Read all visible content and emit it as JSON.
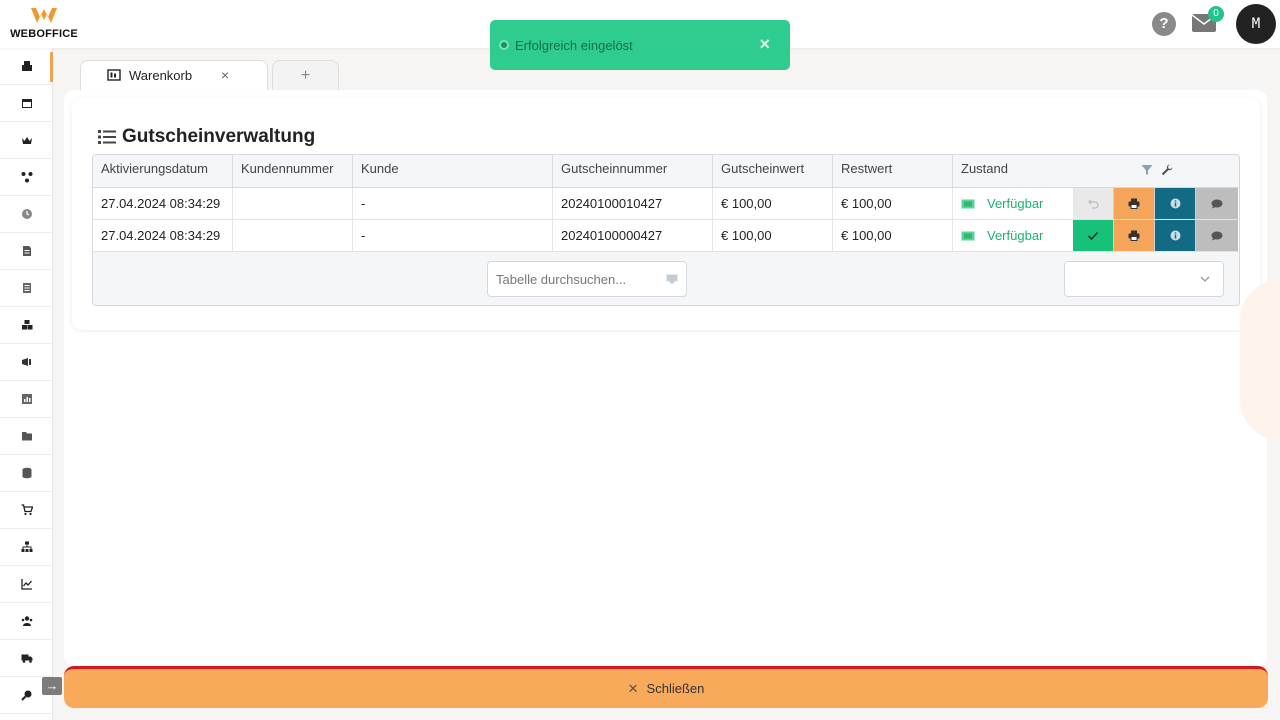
{
  "brand": {
    "logo_text": "WEBOFFICE"
  },
  "header": {
    "help_label": "?",
    "mail_count": "0",
    "avatar_initial": "M"
  },
  "toast": {
    "message": "Erfolgreich eingelöst",
    "close_label": "×"
  },
  "tabs": [
    {
      "label": "Warenkorb",
      "icon": "cart-list-icon",
      "close_label": "×"
    },
    {
      "label": "+"
    }
  ],
  "page": {
    "title": "Gutscheinverwaltung"
  },
  "table": {
    "columns": [
      "Aktivierungsdatum",
      "Kundennummer",
      "Kunde",
      "Gutscheinnummer",
      "Gutscheinwert",
      "Restwert",
      "Zustand"
    ],
    "rows": [
      {
        "aktivierungsdatum": "27.04.2024 08:34:29",
        "kundennummer": "",
        "kunde": "-",
        "gutscheinnummer": "20240100010427",
        "gutscheinwert": "€ 100,00",
        "restwert": "€ 100,00",
        "zustand": "Verfügbar"
      },
      {
        "aktivierungsdatum": "27.04.2024 08:34:29",
        "kundennummer": "",
        "kunde": "-",
        "gutscheinnummer": "20240100000427",
        "gutscheinwert": "€ 100,00",
        "restwert": "€ 100,00",
        "zustand": "Verfügbar"
      }
    ],
    "search_placeholder": "Tabelle durchsuchen...",
    "page_size_value": ""
  },
  "footer": {
    "close_label": "Schließen"
  },
  "colors": {
    "accent": "#f5a24d",
    "toast_bg": "#2ecc8f",
    "status_green": "#1bb36a",
    "print_btn": "#f5a55a",
    "info_btn": "#136a84",
    "close_bar": "#f8a95a"
  }
}
